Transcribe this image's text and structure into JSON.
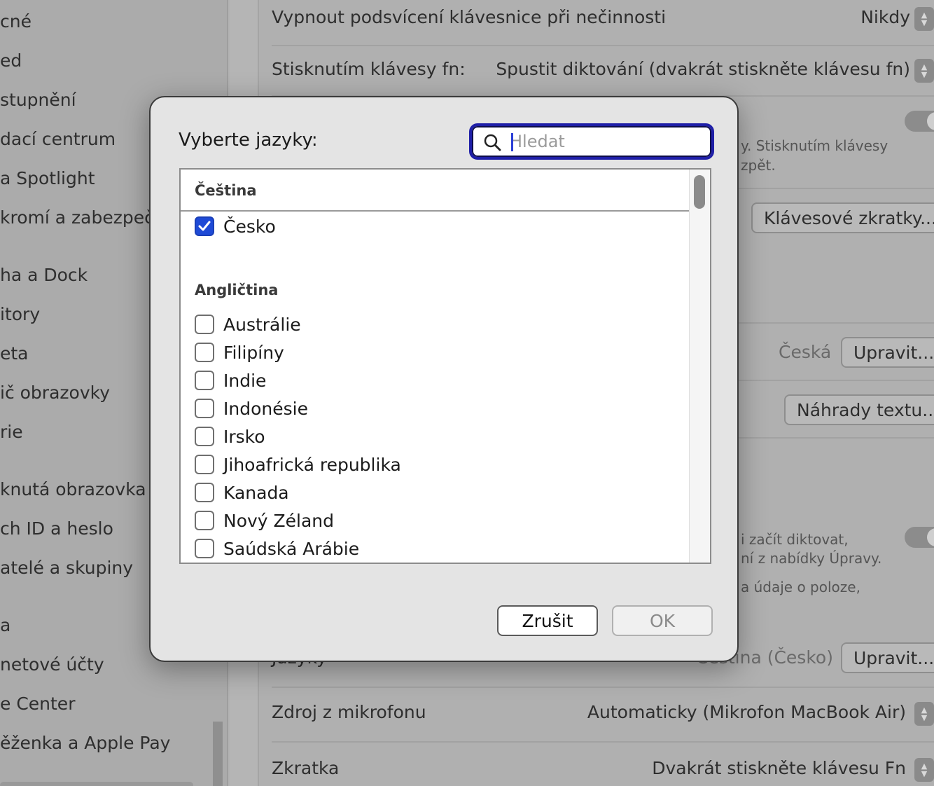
{
  "sidebar": {
    "items": [
      "cné",
      "ed",
      "stupnění",
      "dací centrum",
      "a Spotlight",
      "kromí a zabezpeče",
      "ha a Dock",
      "itory",
      "eta",
      "ič obrazovky",
      "rie",
      "knutá obrazovka",
      "ch ID a heslo",
      "atelé a skupiny",
      "a",
      "netové účty",
      "e Center",
      "ěženka a Apple Pay"
    ]
  },
  "settings": {
    "backlight_label": "Vypnout podsvícení klávesnice při nečinnosti",
    "backlight_value": "Nikdy",
    "fn_label": "Stisknutím klávesy fn:",
    "fn_value": "Spustit diktování (dvakrát stiskněte klávesu fn)",
    "partial_text_1": "y. Stisknutím klávesy",
    "partial_text_2": "zpět.",
    "shortcuts_button": "Klávesové zkratky...",
    "input_source_value": "Česká",
    "edit_button_1": "Upravit...",
    "text_replacements_button": "Náhrady textu...",
    "dictation_text_1": "i začít diktovat,",
    "dictation_text_2": "ní z nabídky Úpravy.",
    "dictation_text_3": "a údaje o poloze,",
    "languages_label": "Jazyky",
    "languages_value": "Čeština (Česko)",
    "edit_button_2": "Upravit...",
    "mic_label": "Zdroj z mikrofonu",
    "mic_value": "Automaticky (Mikrofon MacBook Air)",
    "shortcut_label": "Zkratka",
    "shortcut_value": "Dvakrát stiskněte klávesu Fn"
  },
  "dialog": {
    "title": "Vyberte jazyky:",
    "search_placeholder": "Hledat",
    "groups": [
      {
        "header": "Čeština",
        "items": [
          {
            "label": "Česko",
            "checked": true
          }
        ]
      },
      {
        "header": "Angličtina",
        "items": [
          {
            "label": "Austrálie",
            "checked": false
          },
          {
            "label": "Filipíny",
            "checked": false
          },
          {
            "label": "Indie",
            "checked": false
          },
          {
            "label": "Indonésie",
            "checked": false
          },
          {
            "label": "Irsko",
            "checked": false
          },
          {
            "label": "Jihoafrická republika",
            "checked": false
          },
          {
            "label": "Kanada",
            "checked": false
          },
          {
            "label": "Nový Zéland",
            "checked": false
          },
          {
            "label": "Saúdská Arábie",
            "checked": false
          }
        ]
      }
    ],
    "cancel_label": "Zrušit",
    "ok_label": "OK"
  },
  "colors": {
    "accent": "#1e4ad6",
    "focus_ring": "#1f1fa8"
  }
}
